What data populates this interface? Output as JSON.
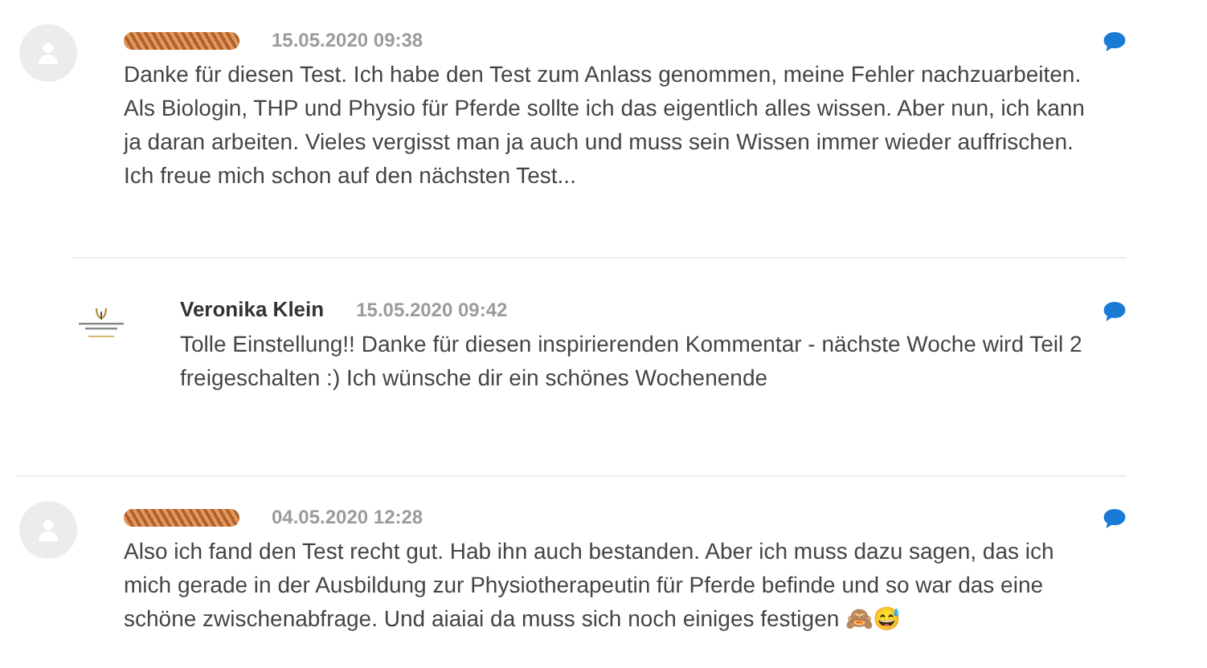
{
  "comments": [
    {
      "avatar": {
        "kind": "placeholder"
      },
      "author": {
        "kind": "redacted"
      },
      "date": "15.05.2020 09:38",
      "text": "Danke für diesen Test. Ich habe den Test zum Anlass genommen, meine Fehler nachzuarbeiten. Als Biologin, THP und Physio für Pferde sollte ich das eigentlich alles wissen. Aber nun, ich kann ja daran arbeiten. Vieles vergisst man ja auch und muss sein Wissen immer wieder auffrischen. Ich freue mich schon auf den nächsten Test...",
      "replies": [
        {
          "avatar": {
            "kind": "logo"
          },
          "author": {
            "kind": "named",
            "name": "Veronika Klein"
          },
          "date": "15.05.2020 09:42",
          "text": "Tolle Einstellung!! Danke für diesen inspirierenden Kommentar - nächste Woche wird Teil 2 freigeschalten :) Ich wünsche dir ein schönes Wochenende"
        }
      ]
    },
    {
      "avatar": {
        "kind": "placeholder"
      },
      "author": {
        "kind": "redacted"
      },
      "date": "04.05.2020 12:28",
      "text": "Also ich fand den Test recht gut. Hab ihn auch bestanden. Aber ich muss dazu sagen, das ich mich gerade in der Ausbildung zur Physiotherapeutin für Pferde befinde und so war das eine schöne zwischenabfrage. Und aiaiai da muss sich noch einiges festigen 🙈😅"
    }
  ]
}
